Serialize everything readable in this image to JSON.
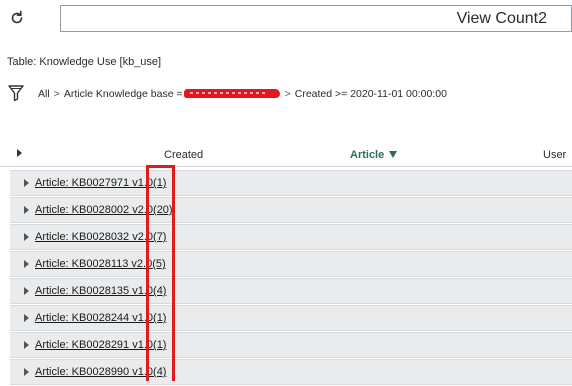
{
  "header": {
    "title": "View Count2",
    "refresh_icon": "refresh-icon"
  },
  "table_label": "Table: Knowledge Use [kb_use]",
  "breadcrumb": {
    "filter_icon": "funnel-icon",
    "all": "All",
    "separator": ">",
    "item1_prefix": "Article Knowledge base =",
    "item2": "Created >= 2020-11-01 00:00:00"
  },
  "columns": {
    "created": "Created",
    "article": "Article",
    "user": "User",
    "sort_indicator": "sort-descending-icon"
  },
  "groups": [
    {
      "label": "Article: KB0027971 v1.0",
      "count": "(1)"
    },
    {
      "label": "Article: KB0028002 v2.0",
      "count": "(20)"
    },
    {
      "label": "Article: KB0028032 v2.0",
      "count": "(7)"
    },
    {
      "label": "Article: KB0028113 v2.0",
      "count": "(5)"
    },
    {
      "label": "Article: KB0028135 v1.0",
      "count": "(4)"
    },
    {
      "label": "Article: KB0028244 v1.0",
      "count": "(1)"
    },
    {
      "label": "Article: KB0028291 v1.0",
      "count": "(1)"
    },
    {
      "label": "Article: KB0028990 v1.0",
      "count": "(4)"
    }
  ],
  "colors": {
    "highlight": "#e31a1c",
    "sorted_column": "#2b6e55",
    "group_row_bg": "#e9ebed",
    "redaction": "#e8131b"
  }
}
